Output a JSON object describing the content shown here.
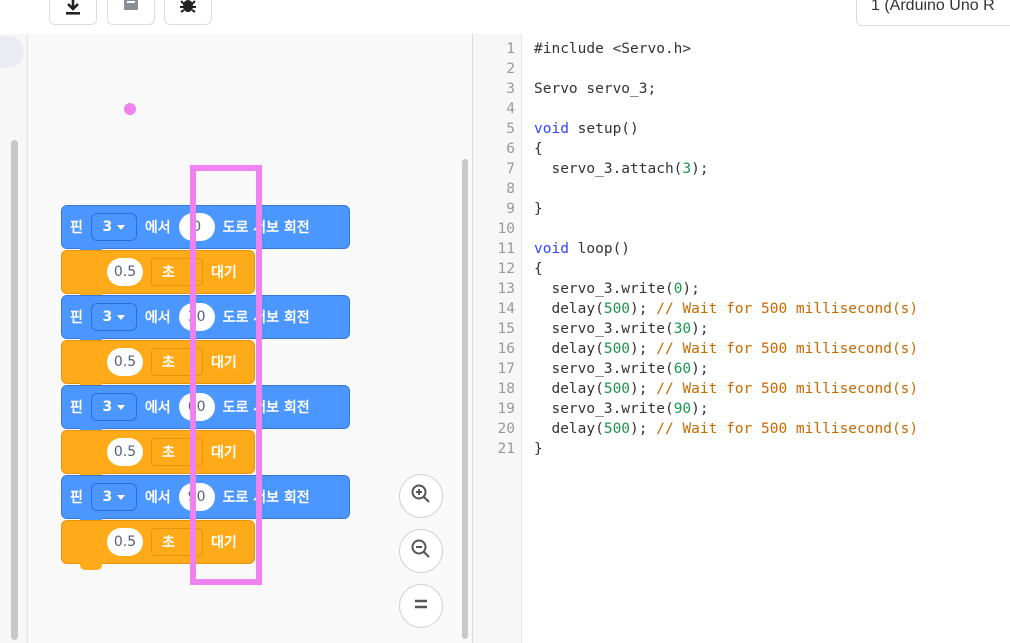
{
  "toolbar": {
    "buttons": [
      {
        "name": "download-icon"
      },
      {
        "name": "save-icon"
      },
      {
        "name": "bug-icon"
      }
    ],
    "board_label": "1 (Arduino Uno R"
  },
  "blocks": [
    {
      "pin_label": "핀",
      "pin_value": "3",
      "from_label": "에서",
      "angle": "0",
      "rotate_label": "도로 서보 회전"
    },
    {
      "delay_value": "0.5",
      "unit_label": "초",
      "wait_label": "대기"
    },
    {
      "pin_label": "핀",
      "pin_value": "3",
      "from_label": "에서",
      "angle": "30",
      "rotate_label": "도로 서보 회전"
    },
    {
      "delay_value": "0.5",
      "unit_label": "초",
      "wait_label": "대기"
    },
    {
      "pin_label": "핀",
      "pin_value": "3",
      "from_label": "에서",
      "angle": "60",
      "rotate_label": "도로 서보 회전"
    },
    {
      "delay_value": "0.5",
      "unit_label": "초",
      "wait_label": "대기"
    },
    {
      "pin_label": "핀",
      "pin_value": "3",
      "from_label": "에서",
      "angle": "90",
      "rotate_label": "도로 서보 회전"
    },
    {
      "delay_value": "0.5",
      "unit_label": "초",
      "wait_label": "대기"
    }
  ],
  "zoom_controls": [
    "zoom-in-icon",
    "zoom-out-icon",
    "zoom-reset-icon"
  ],
  "colors": {
    "motion_block": "#4c97ff",
    "control_block": "#ffab19",
    "highlight": "#ee82ee",
    "keyword": "#3344ff",
    "number": "#1a9a4a",
    "comment": "#c96a00"
  },
  "code_lines": [
    {
      "n": "1",
      "tokens": [
        {
          "t": "#include <Servo.h>",
          "c": "plain"
        }
      ]
    },
    {
      "n": "2",
      "tokens": []
    },
    {
      "n": "3",
      "tokens": [
        {
          "t": "Servo servo_3;",
          "c": "plain"
        }
      ]
    },
    {
      "n": "4",
      "tokens": []
    },
    {
      "n": "5",
      "tokens": [
        {
          "t": "void",
          "c": "kw"
        },
        {
          "t": " setup()",
          "c": "plain"
        }
      ]
    },
    {
      "n": "6",
      "tokens": [
        {
          "t": "{",
          "c": "plain"
        }
      ]
    },
    {
      "n": "7",
      "tokens": [
        {
          "t": "  servo_3.attach(",
          "c": "plain"
        },
        {
          "t": "3",
          "c": "num"
        },
        {
          "t": ");",
          "c": "plain"
        }
      ]
    },
    {
      "n": "8",
      "tokens": []
    },
    {
      "n": "9",
      "tokens": [
        {
          "t": "}",
          "c": "plain"
        }
      ]
    },
    {
      "n": "10",
      "tokens": []
    },
    {
      "n": "11",
      "tokens": [
        {
          "t": "void",
          "c": "kw"
        },
        {
          "t": " loop()",
          "c": "plain"
        }
      ]
    },
    {
      "n": "12",
      "tokens": [
        {
          "t": "{",
          "c": "plain"
        }
      ]
    },
    {
      "n": "13",
      "tokens": [
        {
          "t": "  servo_3.write(",
          "c": "plain"
        },
        {
          "t": "0",
          "c": "num"
        },
        {
          "t": ");",
          "c": "plain"
        }
      ]
    },
    {
      "n": "14",
      "tokens": [
        {
          "t": "  delay(",
          "c": "plain"
        },
        {
          "t": "500",
          "c": "num"
        },
        {
          "t": "); ",
          "c": "plain"
        },
        {
          "t": "// Wait for 500 millisecond(s)",
          "c": "cmt"
        }
      ]
    },
    {
      "n": "15",
      "tokens": [
        {
          "t": "  servo_3.write(",
          "c": "plain"
        },
        {
          "t": "30",
          "c": "num"
        },
        {
          "t": ");",
          "c": "plain"
        }
      ]
    },
    {
      "n": "16",
      "tokens": [
        {
          "t": "  delay(",
          "c": "plain"
        },
        {
          "t": "500",
          "c": "num"
        },
        {
          "t": "); ",
          "c": "plain"
        },
        {
          "t": "// Wait for 500 millisecond(s)",
          "c": "cmt"
        }
      ]
    },
    {
      "n": "17",
      "tokens": [
        {
          "t": "  servo_3.write(",
          "c": "plain"
        },
        {
          "t": "60",
          "c": "num"
        },
        {
          "t": ");",
          "c": "plain"
        }
      ]
    },
    {
      "n": "18",
      "tokens": [
        {
          "t": "  delay(",
          "c": "plain"
        },
        {
          "t": "500",
          "c": "num"
        },
        {
          "t": "); ",
          "c": "plain"
        },
        {
          "t": "// Wait for 500 millisecond(s)",
          "c": "cmt"
        }
      ]
    },
    {
      "n": "19",
      "tokens": [
        {
          "t": "  servo_3.write(",
          "c": "plain"
        },
        {
          "t": "90",
          "c": "num"
        },
        {
          "t": ");",
          "c": "plain"
        }
      ]
    },
    {
      "n": "20",
      "tokens": [
        {
          "t": "  delay(",
          "c": "plain"
        },
        {
          "t": "500",
          "c": "num"
        },
        {
          "t": "); ",
          "c": "plain"
        },
        {
          "t": "// Wait for 500 millisecond(s)",
          "c": "cmt"
        }
      ]
    },
    {
      "n": "21",
      "tokens": [
        {
          "t": "}",
          "c": "plain"
        }
      ]
    }
  ]
}
